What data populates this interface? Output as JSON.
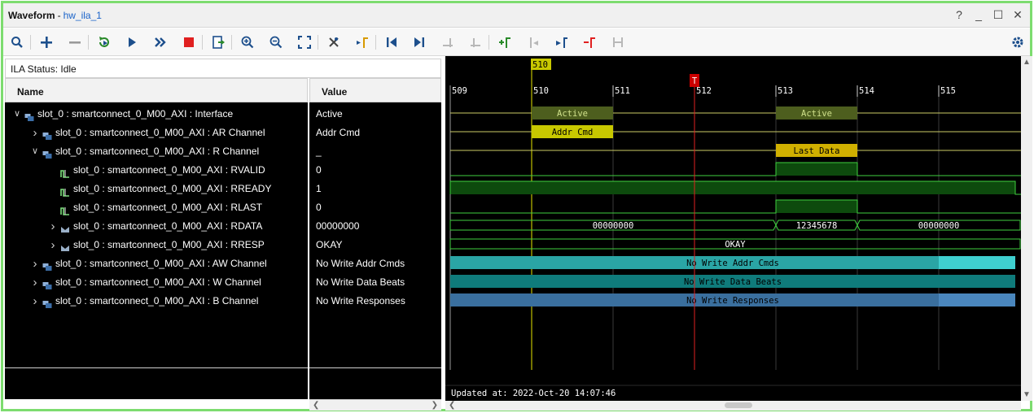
{
  "window": {
    "title": "Waveform",
    "separator": "-",
    "subtitle": "hw_ila_1",
    "controls": [
      "?",
      "_",
      "☐",
      "✕"
    ]
  },
  "toolbar": {
    "icons": [
      "search-icon",
      "add-icon",
      "remove-icon",
      "refresh-trigger-icon",
      "run-trigger-icon",
      "run-immediate-icon",
      "stop-icon",
      "export-icon",
      "zoom-in-icon",
      "zoom-out-icon",
      "zoom-fit-icon",
      "cursor-icon",
      "marker-add-icon",
      "go-to-start-icon",
      "go-to-end-icon",
      "prev-marker-icon",
      "next-marker-icon",
      "add-marker-icon",
      "prev-marker-jump-icon",
      "next-marker-jump-icon",
      "delete-marker-icon",
      "swap-icon",
      "settings-icon"
    ]
  },
  "ila_status": "ILA Status: Idle",
  "columns": {
    "name": "Name",
    "value": "Value"
  },
  "signals": [
    {
      "name": "slot_0 : smartconnect_0_M00_AXI : Interface",
      "value": "Active",
      "level": 0,
      "expander": "expanded",
      "icon": "interface-icon"
    },
    {
      "name": "slot_0 : smartconnect_0_M00_AXI : AR Channel",
      "value": "Addr Cmd",
      "level": 1,
      "expander": "collapsed",
      "icon": "channel-icon"
    },
    {
      "name": "slot_0 : smartconnect_0_M00_AXI : R Channel",
      "value": "_",
      "level": 1,
      "expander": "expanded",
      "icon": "channel-icon"
    },
    {
      "name": "slot_0 : smartconnect_0_M00_AXI : RVALID",
      "value": "0",
      "level": 2,
      "expander": "none",
      "icon": "bit-signal-icon"
    },
    {
      "name": "slot_0 : smartconnect_0_M00_AXI : RREADY",
      "value": "1",
      "level": 2,
      "expander": "none",
      "icon": "bit-signal-icon"
    },
    {
      "name": "slot_0 : smartconnect_0_M00_AXI : RLAST",
      "value": "0",
      "level": 2,
      "expander": "none",
      "icon": "bit-signal-icon"
    },
    {
      "name": "slot_0 : smartconnect_0_M00_AXI : RDATA",
      "value": "00000000",
      "level": 2,
      "expander": "collapsed",
      "icon": "bus-signal-icon"
    },
    {
      "name": "slot_0 : smartconnect_0_M00_AXI : RRESP",
      "value": "OKAY",
      "level": 2,
      "expander": "collapsed",
      "icon": "bus-signal-icon"
    },
    {
      "name": "slot_0 : smartconnect_0_M00_AXI : AW Channel",
      "value": "No Write Addr Cmds",
      "level": 1,
      "expander": "collapsed",
      "icon": "channel-icon"
    },
    {
      "name": "slot_0 : smartconnect_0_M00_AXI : W Channel",
      "value": "No Write Data Beats",
      "level": 1,
      "expander": "collapsed",
      "icon": "channel-icon"
    },
    {
      "name": "slot_0 : smartconnect_0_M00_AXI : B Channel",
      "value": "No Write Responses",
      "level": 1,
      "expander": "collapsed",
      "icon": "channel-icon"
    }
  ],
  "waveform": {
    "time_range": [
      509,
      516
    ],
    "ticks": [
      "509",
      "510",
      "511",
      "512",
      "513",
      "514",
      "515"
    ],
    "marker": {
      "label": "510",
      "time": 510
    },
    "trigger": {
      "label": "T",
      "time": 512
    },
    "traces": [
      {
        "kind": "bus-status",
        "segments": [
          {
            "from": 510,
            "to": 511,
            "text": "Active",
            "color": "#4d5e1e"
          },
          {
            "from": 513,
            "to": 514,
            "text": "Active",
            "color": "#4d5e1e"
          }
        ],
        "line_color": "#cccc66"
      },
      {
        "kind": "bus-status",
        "segments": [
          {
            "from": 510,
            "to": 511,
            "text": "Addr Cmd",
            "color": "#c8c800"
          }
        ],
        "line_color": "#cccc66"
      },
      {
        "kind": "bus-status",
        "segments": [
          {
            "from": 513,
            "to": 514,
            "text": "Last Data",
            "color": "#d0b000"
          }
        ],
        "line_color": "#cccc66"
      },
      {
        "kind": "bit",
        "high": [
          [
            513,
            514
          ]
        ]
      },
      {
        "kind": "bit",
        "high": [
          [
            509,
            516
          ]
        ]
      },
      {
        "kind": "bit",
        "high": [
          [
            513,
            514
          ]
        ]
      },
      {
        "kind": "bus",
        "segments": [
          {
            "from": 509,
            "to": 513,
            "text": "00000000"
          },
          {
            "from": 513,
            "to": 514,
            "text": "12345678"
          },
          {
            "from": 514,
            "to": 516,
            "text": "00000000"
          }
        ]
      },
      {
        "kind": "bus",
        "segments": [
          {
            "from": 509,
            "to": 516,
            "text": "OKAY"
          }
        ]
      },
      {
        "kind": "fill",
        "text": "No Write Addr Cmds",
        "color": "#2aa5a5",
        "tail_color": "#3fd0d0"
      },
      {
        "kind": "fill",
        "text": "No Write Data Beats",
        "color": "#0f7b7b",
        "tail_color": "#0f7b7b"
      },
      {
        "kind": "fill",
        "text": "No Write Responses",
        "color": "#3a6f9e",
        "tail_color": "#4a86bd"
      }
    ],
    "updated_at": "Updated at: 2022-Oct-20 14:07:46"
  },
  "colors": {
    "accent_border": "#7ddc6f",
    "link": "#1a63c9",
    "stop": "#e02020"
  }
}
